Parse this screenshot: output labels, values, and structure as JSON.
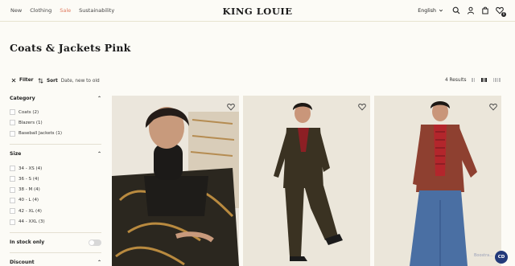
{
  "header": {
    "nav": [
      "New",
      "Clothing",
      "Sale",
      "Sustainability"
    ],
    "logo": "KING LOUIE",
    "language": "English",
    "wishlist_count": "0"
  },
  "page_title": "Coats & Jackets Pink",
  "toolbar": {
    "filter_label": "Filter",
    "sort_label": "Sort",
    "sort_value": "Date, new to old",
    "results": "4 Results"
  },
  "sidebar": {
    "category": {
      "title": "Category",
      "options": [
        "Coats (2)",
        "Blazers (1)",
        "Baseball Jackets (1)"
      ]
    },
    "size": {
      "title": "Size",
      "options": [
        "34 - XS (4)",
        "36 - S (4)",
        "38 - M (4)",
        "40 - L (4)",
        "42 - XL (4)",
        "44 - XXL (3)"
      ]
    },
    "stock": {
      "label": "In stock only"
    },
    "discount": {
      "title": "Discount"
    }
  },
  "chat_button": "CD",
  "icons": [
    "chevron-down-icon",
    "search-icon",
    "user-icon",
    "bag-icon",
    "heart-icon",
    "close-icon",
    "sort-icon",
    "chevron-up-icon"
  ]
}
